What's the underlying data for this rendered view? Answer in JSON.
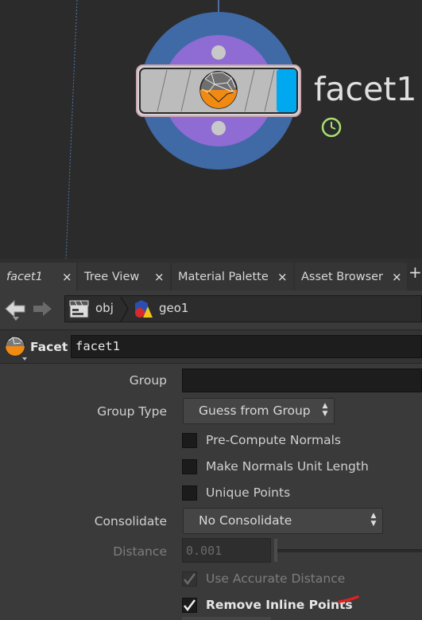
{
  "network": {
    "node_name": "facet1"
  },
  "tabs": [
    {
      "label": "facet1",
      "close": "×"
    },
    {
      "label": "Tree View",
      "close": "×"
    },
    {
      "label": "Material Palette",
      "close": "×"
    },
    {
      "label": "Asset Browser",
      "close": "×"
    }
  ],
  "tab_add": "+",
  "path": {
    "crumbs": [
      {
        "label": "obj",
        "icon": "clapperboard-icon"
      },
      {
        "label": "geo1",
        "icon": "geo-shapes-icon"
      }
    ]
  },
  "params": {
    "op_type": "Facet",
    "node_name_value": "facet1",
    "group_label": "Group",
    "group_value": "",
    "group_type_label": "Group Type",
    "group_type_value": "Guess from Group",
    "pre_compute_normals": "Pre-Compute Normals",
    "make_normals_unit": "Make Normals Unit Length",
    "unique_points": "Unique Points",
    "consolidate_label": "Consolidate",
    "consolidate_value": "No Consolidate",
    "distance_label": "Distance",
    "distance_value": "0.001",
    "use_accurate_distance": "Use Accurate Distance",
    "remove_inline_points": "Remove Inline Points"
  },
  "colors": {
    "node_outer_ring": "#3f6aa6",
    "node_inner_ring": "#8f6bd4",
    "node_flag": "#00a8f0",
    "annotation_red": "#e02020",
    "clock_badge": "#a8e070"
  }
}
